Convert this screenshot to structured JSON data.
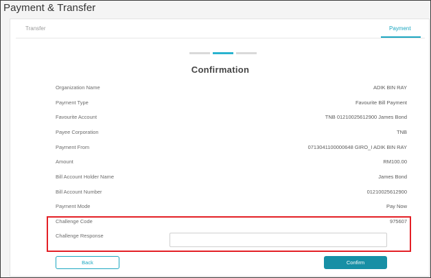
{
  "app": {
    "title": "Payment & Transfer"
  },
  "tabs": [
    {
      "label": "Transfer",
      "active": false
    },
    {
      "label": "Payment",
      "active": true
    }
  ],
  "stepper": {
    "total_steps": 3,
    "current_step": 2
  },
  "main": {
    "heading": "Confirmation"
  },
  "details": [
    {
      "label": "Organization Name",
      "value": "ADIK BIN RAY"
    },
    {
      "label": "Payment Type",
      "value": "Favourite Bill Payment"
    },
    {
      "label": "Favourite Account",
      "value": "TNB 01210025612900 James Bond"
    },
    {
      "label": "Payee Corporation",
      "value": "TNB"
    },
    {
      "label": "Payment From",
      "value": "0713041100000648 GIRO_I ADIK BIN RAY"
    },
    {
      "label": "Amount",
      "value": "RM100.00"
    },
    {
      "label": "Bill Account Holder Name",
      "value": "James Bond"
    },
    {
      "label": "Bill Account Number",
      "value": "01210025612900"
    },
    {
      "label": "Payment Mode",
      "value": "Pay Now"
    }
  ],
  "challenge": {
    "code_label": "Challenge Code",
    "code_value": "975607",
    "response_label": "Challenge Response",
    "response_value": "",
    "highlight_color": "#e31e24"
  },
  "actions": {
    "back_label": "Back",
    "confirm_label": "Confirm"
  },
  "colors": {
    "accent": "#1aa6c0",
    "confirm_bg": "#178fa5"
  }
}
